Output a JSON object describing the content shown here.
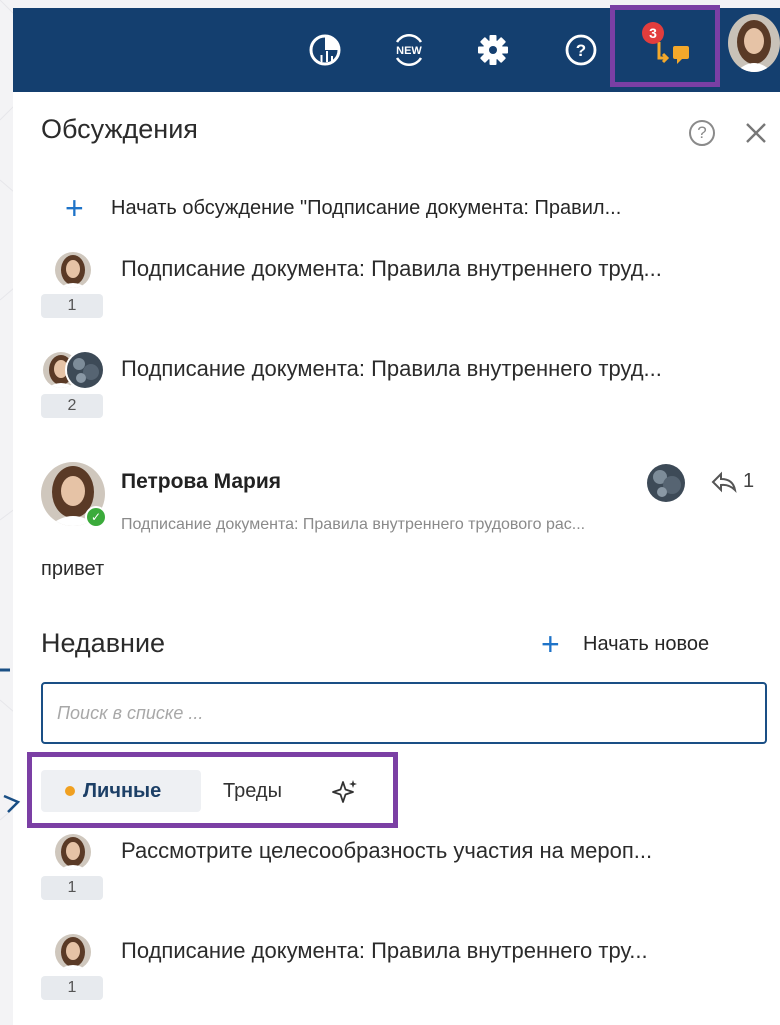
{
  "header": {
    "badge_count": "3",
    "icons": [
      "analytics-icon",
      "new-features-icon",
      "settings-gear-icon",
      "help-icon",
      "discussions-icon",
      "user-avatar"
    ]
  },
  "discussions_panel": {
    "title": "Обсуждения",
    "start_discussion_label": "Начать обсуждение \"Подписание документа: Правил...",
    "items": [
      {
        "text": "Подписание документа: Правила внутреннего труд...",
        "count": "1"
      },
      {
        "text": "Подписание документа: Правила внутреннего труд...",
        "count": "2"
      }
    ],
    "message": {
      "author": "Петрова Мария",
      "subject": "Подписание документа: Правила внутреннего трудового рас...",
      "reply_count": "1",
      "body": "привет"
    }
  },
  "recent": {
    "title": "Недавние",
    "start_new_label": "Начать новое",
    "search_placeholder": "Поиск в списке ...",
    "filters": {
      "personal": "Личные",
      "threads": "Треды"
    },
    "items": [
      {
        "text": "Рассмотрите целесообразность участия на мероп...",
        "count": "1"
      },
      {
        "text": "Подписание документа: Правила внутреннего тру...",
        "count": "1"
      }
    ]
  },
  "colors": {
    "header_bg": "#143f6f",
    "highlight_frame": "#7b3fa4",
    "accent_blue": "#1e73c8",
    "badge_red": "#e23d3d",
    "online_green": "#3bab3b",
    "personal_dot": "#f0a020"
  }
}
